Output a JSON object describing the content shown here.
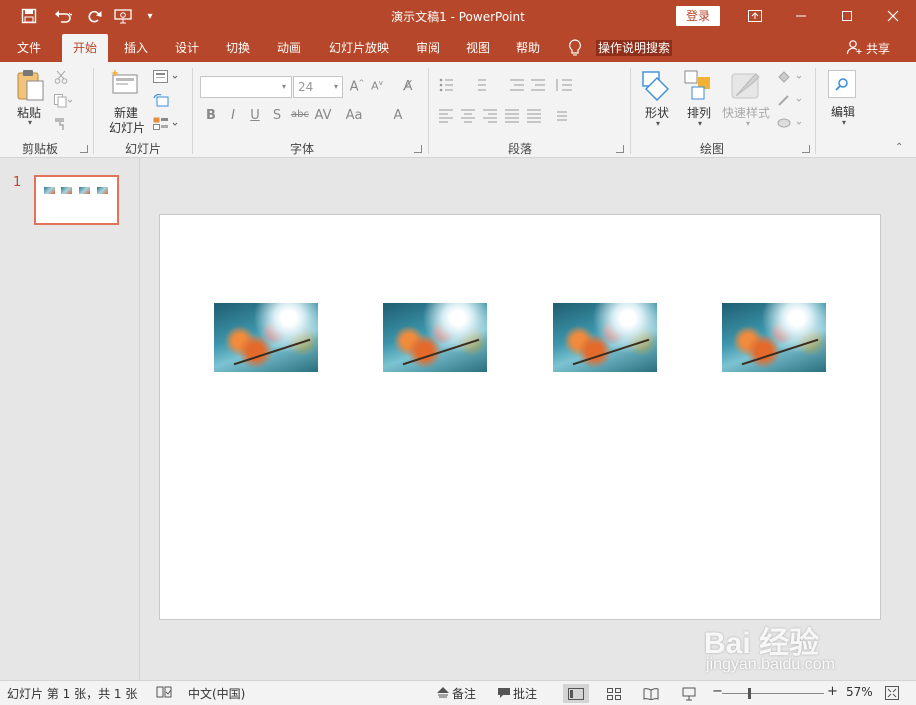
{
  "title_bar": {
    "document_title": "演示文稿1  -  PowerPoint",
    "login_label": "登录",
    "quick_access": {
      "save_icon": "save-icon",
      "undo_icon": "undo-icon",
      "redo_icon": "redo-icon",
      "present_icon": "present-from-start-icon",
      "customize_icon": "customize-qat-icon"
    }
  },
  "ribbon_tabs": [
    {
      "label": "文件",
      "active": false
    },
    {
      "label": "开始",
      "active": true
    },
    {
      "label": "插入",
      "active": false
    },
    {
      "label": "设计",
      "active": false
    },
    {
      "label": "切换",
      "active": false
    },
    {
      "label": "动画",
      "active": false
    },
    {
      "label": "幻灯片放映",
      "active": false
    },
    {
      "label": "审阅",
      "active": false
    },
    {
      "label": "视图",
      "active": false
    },
    {
      "label": "帮助",
      "active": false
    }
  ],
  "tell_me": "操作说明搜索",
  "share_label": "共享",
  "groups": {
    "clipboard": {
      "label": "剪贴板",
      "paste_label": "粘贴"
    },
    "slides": {
      "label": "幻灯片",
      "new_slide_line1": "新建",
      "new_slide_line2": "幻灯片"
    },
    "font": {
      "label": "字体",
      "font_size": "24",
      "font_name": ""
    },
    "paragraph": {
      "label": "段落"
    },
    "drawing": {
      "label": "绘图",
      "shapes_label": "形状",
      "arrange_label": "排列",
      "quick_styles_label": "快速样式"
    },
    "editing": {
      "label": "编辑"
    }
  },
  "thumbnails": {
    "slide_number": "1"
  },
  "slide": {
    "images": 4
  },
  "watermark": {
    "main": "Bai 经验",
    "sub": "jingyan.baidu.com"
  },
  "status_bar": {
    "slide_info": "幻灯片 第 1 张，共 1 张",
    "language": "中文(中国)",
    "notes_label": "备注",
    "comments_label": "批注",
    "zoom": "57%",
    "zoom_fraction": 0.57
  },
  "colors": {
    "accent": "#b7472a",
    "tab_bg": "#f3f3f3",
    "thumb_border": "#e0735a"
  }
}
